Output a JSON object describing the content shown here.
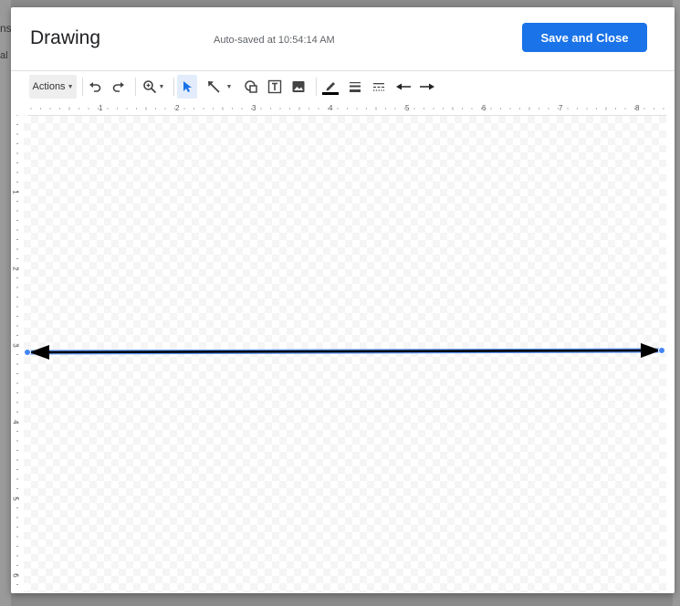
{
  "background": {
    "left_text_1": "ns",
    "left_text_2": "al"
  },
  "dialog": {
    "title": "Drawing",
    "autosave": "Auto-saved at 10:54:14 AM",
    "save_close_label": "Save and Close"
  },
  "toolbar": {
    "actions_label": "Actions",
    "icons": [
      "undo-icon",
      "redo-icon",
      "zoom-icon",
      "select-icon",
      "line-icon",
      "shape-icon",
      "text-box-icon",
      "image-icon",
      "line-color-icon",
      "line-weight-icon",
      "line-dash-icon",
      "line-start-icon",
      "line-end-icon"
    ]
  },
  "rulers": {
    "horizontal": [
      "1",
      "2",
      "3",
      "4",
      "5",
      "6",
      "7",
      "8"
    ],
    "vertical": [
      "1",
      "2",
      "3",
      "4",
      "5",
      "6"
    ]
  },
  "colors": {
    "accent": "#1a73e8",
    "selection": "#4285f4",
    "line": "#000000"
  }
}
